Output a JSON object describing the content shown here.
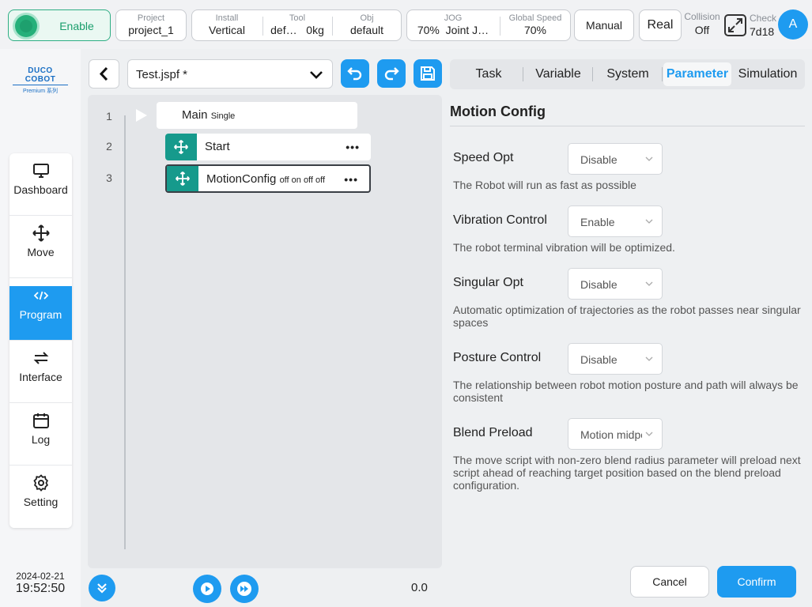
{
  "topbar": {
    "enable_label": "Enable",
    "project": {
      "label": "Project",
      "value": "project_1"
    },
    "install": {
      "label": "Install",
      "value": "Vertical"
    },
    "tool": {
      "label": "Tool",
      "value_name": "def…",
      "value_weight": "0kg"
    },
    "obj": {
      "label": "Obj",
      "value": "default"
    },
    "jog": {
      "label": "JOG",
      "value_pct": "70%",
      "value_mode": "Joint J…"
    },
    "global_speed": {
      "label": "Global Speed",
      "value": "70%"
    },
    "manual_label": "Manual",
    "real_label": "Real",
    "collision": {
      "label": "Collision",
      "value": "Off"
    },
    "check": {
      "label": "Check",
      "value": "7d18"
    },
    "avatar_letter": "A"
  },
  "sidebar": {
    "logo_brand": "DUCO COBOT",
    "logo_sub": "Premium 系列",
    "items": [
      {
        "label": "Dashboard",
        "icon": "monitor-icon"
      },
      {
        "label": "Move",
        "icon": "move-arrows-icon"
      },
      {
        "label": "Program",
        "icon": "code-icon"
      },
      {
        "label": "Interface",
        "icon": "swap-arrows-icon"
      },
      {
        "label": "Log",
        "icon": "calendar-icon"
      },
      {
        "label": "Setting",
        "icon": "gear-icon"
      }
    ],
    "active_item": "Program",
    "date": "2024-02-21",
    "time": "19:52:50"
  },
  "program": {
    "file_name": "Test.jspf *",
    "lines": [
      "1",
      "2",
      "3"
    ],
    "main_node": {
      "title": "Main",
      "sub": "Single"
    },
    "nodes": [
      {
        "title": "Start",
        "params": ""
      },
      {
        "title": "MotionConfig",
        "params": "off on off off"
      }
    ],
    "progress_value": "0.0"
  },
  "tabs": [
    "Task",
    "Variable",
    "System",
    "Parameter",
    "Simulation"
  ],
  "active_tab": "Parameter",
  "config": {
    "title": "Motion Config",
    "params": [
      {
        "label": "Speed Opt",
        "value": "Disable",
        "desc": "The Robot will run as fast as possible"
      },
      {
        "label": "Vibration Control",
        "value": "Enable",
        "desc": "The robot terminal vibration will be optimized."
      },
      {
        "label": "Singular Opt",
        "value": "Disable",
        "desc": "Automatic optimization of trajectories as the robot passes near singular spaces"
      },
      {
        "label": "Posture Control",
        "value": "Disable",
        "desc": "The relationship between robot motion posture and path will always be consistent"
      },
      {
        "label": "Blend Preload",
        "value": "Motion midpoint",
        "desc": "The move script with non-zero blend radius parameter will preload next script ahead of reaching target position based on the blend preload configuration."
      }
    ],
    "cancel_label": "Cancel",
    "confirm_label": "Confirm"
  },
  "colors": {
    "accent": "#1e9bf0",
    "node_teal": "#169a8c",
    "enable_green": "#25b07a"
  }
}
